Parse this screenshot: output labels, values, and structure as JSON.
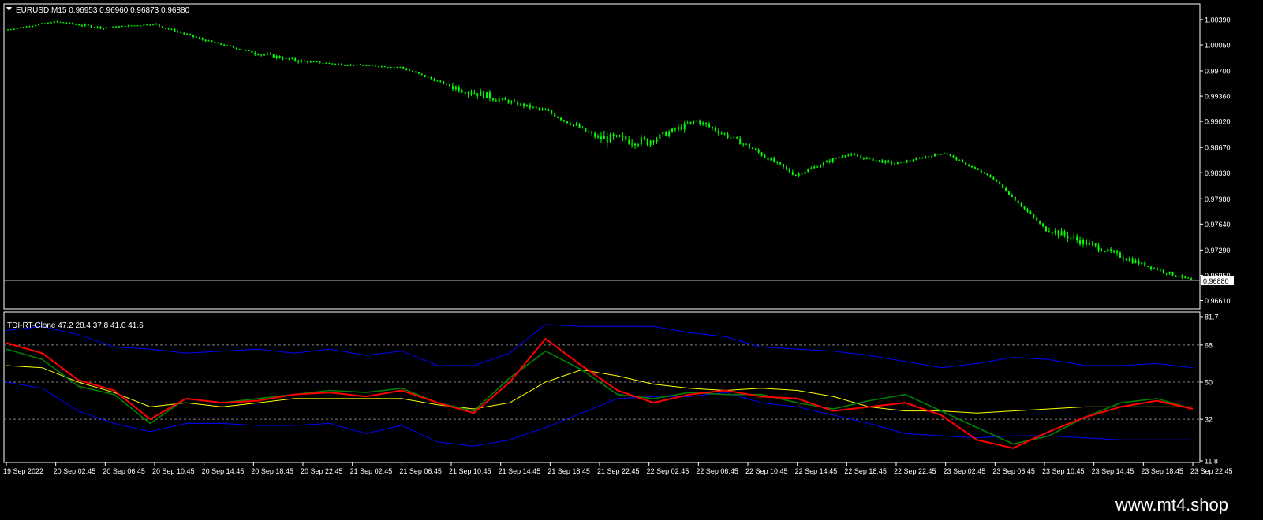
{
  "symbol_info": "EURUSD,M15  0.96953 0.96960 0.96873 0.96880",
  "indicator_info": "TDI-RT-Clone 47.2 28.4 37.8 41.0 41.6",
  "watermark": "www.mt4.shop",
  "colors": {
    "background": "#000000",
    "candles": "#00ff00",
    "frame": "#ffffff",
    "axis_text": "#ffffff",
    "price_line": "#c0c0c0",
    "rsi_line": "#008000",
    "signal_line": "#ff0000",
    "market_base": "#ffff00",
    "volatility_bands": "#0000ff",
    "levels": "#808080"
  },
  "chart_data": [
    {
      "type": "candlestick",
      "title": "EURUSD,M15",
      "ohlc_readout": {
        "open": 0.96953,
        "high": 0.9696,
        "low": 0.96873,
        "close": 0.9688
      },
      "y_ticks": [
        "1.00390",
        "1.00050",
        "0.99700",
        "0.99360",
        "0.99020",
        "0.98670",
        "0.98330",
        "0.97980",
        "0.97640",
        "0.97290",
        "0.96950",
        "0.96610"
      ],
      "ylim": [
        0.9652,
        1.0058
      ],
      "current_price": "0.96880",
      "x": [
        "19 Sep 2022",
        "20 Sep 02:45",
        "20 Sep 06:45",
        "20 Sep 10:45",
        "20 Sep 14:45",
        "20 Sep 18:45",
        "20 Sep 22:45",
        "21 Sep 02:45",
        "21 Sep 06:45",
        "21 Sep 10:45",
        "21 Sep 14:45",
        "21 Sep 18:45",
        "21 Sep 22:45",
        "22 Sep 02:45",
        "22 Sep 06:45",
        "22 Sep 10:45",
        "22 Sep 14:45",
        "22 Sep 18:45",
        "22 Sep 22:45",
        "23 Sep 02:45",
        "23 Sep 06:45",
        "23 Sep 10:45",
        "23 Sep 14:45",
        "23 Sep 18:45",
        "23 Sep 22:45"
      ],
      "close": [
        1.0025,
        1.0036,
        1.0028,
        1.0033,
        1.0012,
        0.9995,
        0.9983,
        0.9978,
        0.9975,
        0.995,
        0.9932,
        0.9915,
        0.988,
        0.9875,
        0.9903,
        0.987,
        0.983,
        0.9858,
        0.9845,
        0.986,
        0.9825,
        0.976,
        0.9735,
        0.971,
        0.9688
      ],
      "high": [
        1.0032,
        1.0049,
        1.0035,
        1.0042,
        1.002,
        1.001,
        0.9995,
        0.9985,
        0.9982,
        0.9968,
        0.9945,
        0.9925,
        0.9918,
        0.9882,
        0.9918,
        0.9885,
        0.9855,
        0.9868,
        0.9856,
        0.9867,
        0.9835,
        0.981,
        0.9755,
        0.9728,
        0.9696
      ],
      "low": [
        1.0018,
        1.0024,
        1.002,
        1.002,
        1.0002,
        0.9972,
        0.9975,
        0.997,
        0.996,
        0.9888,
        0.9905,
        0.987,
        0.9812,
        0.9818,
        0.9865,
        0.984,
        0.982,
        0.9835,
        0.9835,
        0.9848,
        0.981,
        0.9735,
        0.97,
        0.969,
        0.967
      ]
    },
    {
      "type": "line",
      "title": "TDI-RT-Clone",
      "values_readout": [
        47.2,
        28.4,
        37.8,
        41.0,
        41.6
      ],
      "y_ticks": [
        "81.7",
        "68",
        "50",
        "32",
        "11.8"
      ],
      "levels": [
        68,
        50,
        32
      ],
      "ylim": [
        11.8,
        81.7
      ],
      "series": [
        {
          "values": [
            66,
            61,
            48,
            44,
            30,
            42,
            40,
            42,
            44,
            46,
            45,
            47,
            40,
            36,
            52,
            65,
            56,
            44,
            42,
            45,
            44,
            44,
            40,
            37,
            41,
            44,
            36,
            28,
            20,
            24,
            33,
            40,
            42,
            37
          ]
        },
        {
          "values": [
            69,
            64,
            51,
            46,
            32,
            42,
            40,
            41,
            44,
            45,
            43,
            46,
            40,
            35,
            50,
            71,
            58,
            46,
            40,
            44,
            46,
            43,
            42,
            36,
            38,
            40,
            34,
            22,
            18,
            26,
            33,
            38,
            41,
            37
          ]
        },
        {
          "values": [
            58,
            57,
            50,
            45,
            38,
            40,
            38,
            40,
            42,
            42,
            42,
            42,
            39,
            37,
            40,
            50,
            56,
            53,
            49,
            47,
            46,
            47,
            46,
            43,
            38,
            36,
            36,
            35,
            36,
            37,
            38,
            38,
            38,
            38
          ]
        },
        {
          "values": [
            75,
            77,
            73,
            67,
            66,
            64,
            65,
            66,
            64,
            66,
            63,
            65,
            58,
            58,
            64,
            78,
            77,
            77,
            77,
            74,
            72,
            67,
            66,
            65,
            63,
            60,
            57,
            59,
            62,
            61,
            58,
            58,
            59,
            57
          ]
        },
        {
          "values": [
            50,
            47,
            36,
            30,
            26,
            30,
            30,
            29,
            29,
            30,
            25,
            29,
            21,
            19,
            22,
            28,
            35,
            42,
            43,
            43,
            45,
            40,
            38,
            34,
            30,
            25,
            24,
            23,
            24,
            24,
            23,
            22,
            22,
            22
          ]
        }
      ]
    }
  ]
}
